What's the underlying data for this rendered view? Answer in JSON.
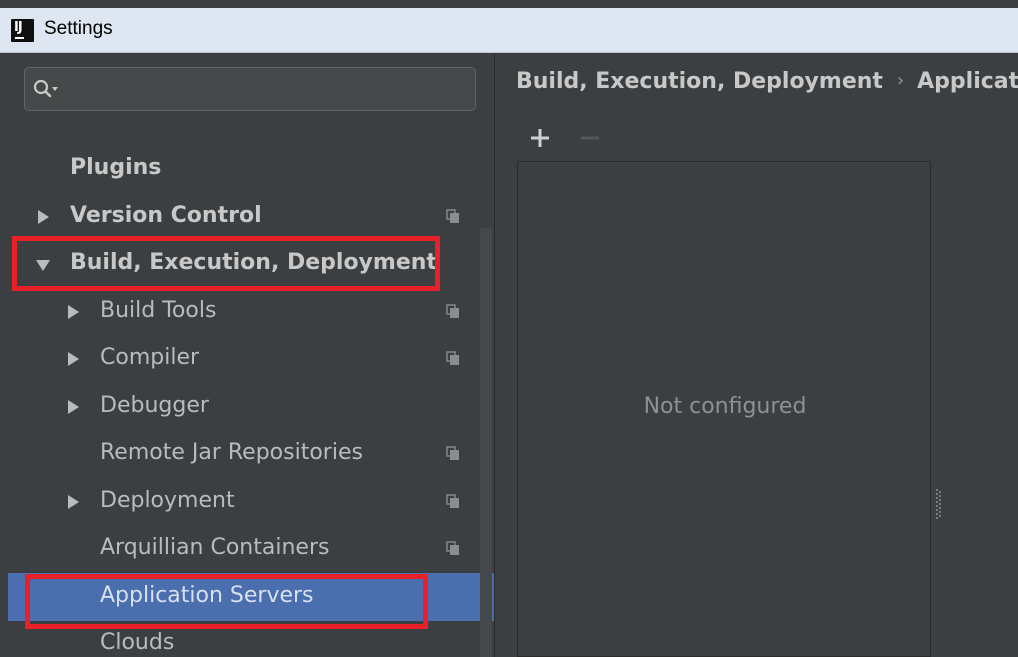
{
  "window": {
    "title": "Settings",
    "logo_text": "IJ"
  },
  "search": {
    "value": "",
    "placeholder": ""
  },
  "tree": [
    {
      "label": "Plugins",
      "bold": true,
      "level": 0,
      "arrow": "none",
      "copy_icon": false,
      "selected": false
    },
    {
      "label": "Version Control",
      "bold": true,
      "level": 0,
      "arrow": "collapsed",
      "copy_icon": true,
      "selected": false
    },
    {
      "label": "Build, Execution, Deployment",
      "bold": true,
      "level": 0,
      "arrow": "expanded",
      "copy_icon": false,
      "selected": false
    },
    {
      "label": "Build Tools",
      "bold": false,
      "level": 1,
      "arrow": "collapsed",
      "copy_icon": true,
      "selected": false
    },
    {
      "label": "Compiler",
      "bold": false,
      "level": 1,
      "arrow": "collapsed",
      "copy_icon": true,
      "selected": false
    },
    {
      "label": "Debugger",
      "bold": false,
      "level": 1,
      "arrow": "collapsed",
      "copy_icon": false,
      "selected": false
    },
    {
      "label": "Remote Jar Repositories",
      "bold": false,
      "level": 1,
      "arrow": "none",
      "copy_icon": true,
      "selected": false
    },
    {
      "label": "Deployment",
      "bold": false,
      "level": 1,
      "arrow": "collapsed",
      "copy_icon": true,
      "selected": false
    },
    {
      "label": "Arquillian Containers",
      "bold": false,
      "level": 1,
      "arrow": "none",
      "copy_icon": true,
      "selected": false
    },
    {
      "label": "Application Servers",
      "bold": false,
      "level": 1,
      "arrow": "none",
      "copy_icon": false,
      "selected": true
    },
    {
      "label": "Clouds",
      "bold": false,
      "level": 1,
      "arrow": "none",
      "copy_icon": false,
      "selected": false
    }
  ],
  "main": {
    "breadcrumb_parent": "Build, Execution, Deployment",
    "breadcrumb_separator": "›",
    "breadcrumb_current": "Applicatio",
    "empty_text": "Not configured"
  },
  "colors": {
    "background": "#3c3f41",
    "selection": "#4b6eaf",
    "highlight": "#e8202a",
    "text": "#bbbbbb"
  }
}
